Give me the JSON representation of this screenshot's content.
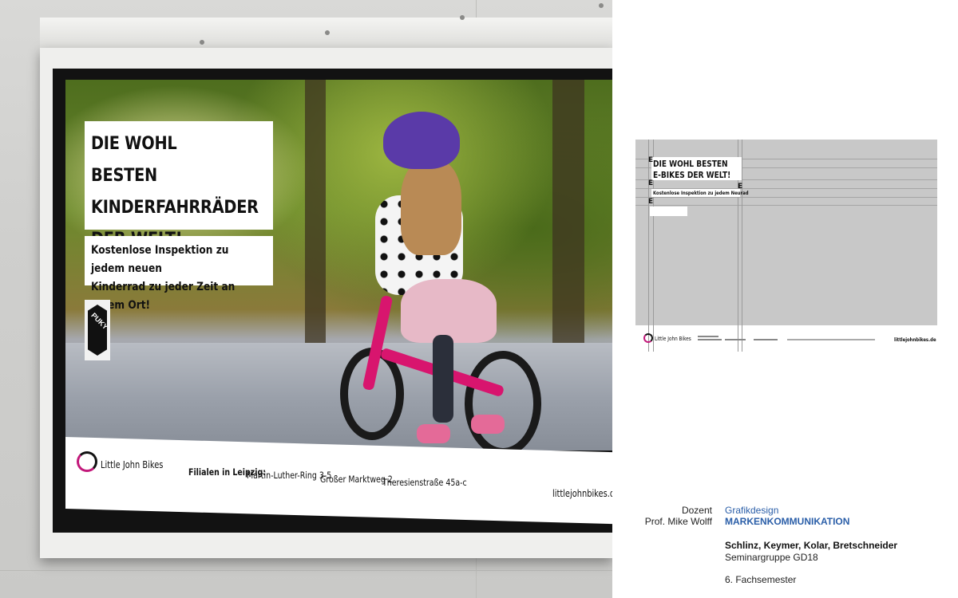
{
  "billboard": {
    "headline": [
      "DIE WOHL BESTEN",
      "KINDERFAHRRÄDER",
      "DER WELT!"
    ],
    "subline": [
      "Kostenlose Inspektion zu jedem neuen",
      "Kinderrad zu jeder Zeit an jedem Ort!"
    ],
    "partner_logo": "PUKY",
    "brand": "Little John Bikes",
    "stores_label": "Filialen in Leipzig:",
    "stores": [
      "Martin-Luther-Ring 3-5",
      "Großer Marktweg 2",
      "Theresienstraße 45a-c"
    ],
    "url": "littlejohnbikes.de",
    "colors": {
      "brand_magenta": "#c2187a",
      "text": "#111111"
    }
  },
  "layout_scheme": {
    "headline": [
      "DIE WOHL BESTEN",
      "E-BIKES DER WELT!"
    ],
    "subline": "Kostenlose Inspektion zu jedem Neurad",
    "e_marks": [
      "E",
      "E",
      "E",
      "E"
    ],
    "brand": "Little John Bikes",
    "url": "littlejohnbikes.de"
  },
  "credits": {
    "lecturer_label": "Dozent",
    "lecturer_name": "Prof. Mike Wolff",
    "course_area": "Grafikdesign",
    "course_title": "MARKENKOMMUNIKATION",
    "authors": "Schlinz, Keymer, Kolar, Bretschneider",
    "group": "Seminargruppe GD18",
    "semester": "6. Fachsemester",
    "accent_color": "#2a5ea8"
  }
}
